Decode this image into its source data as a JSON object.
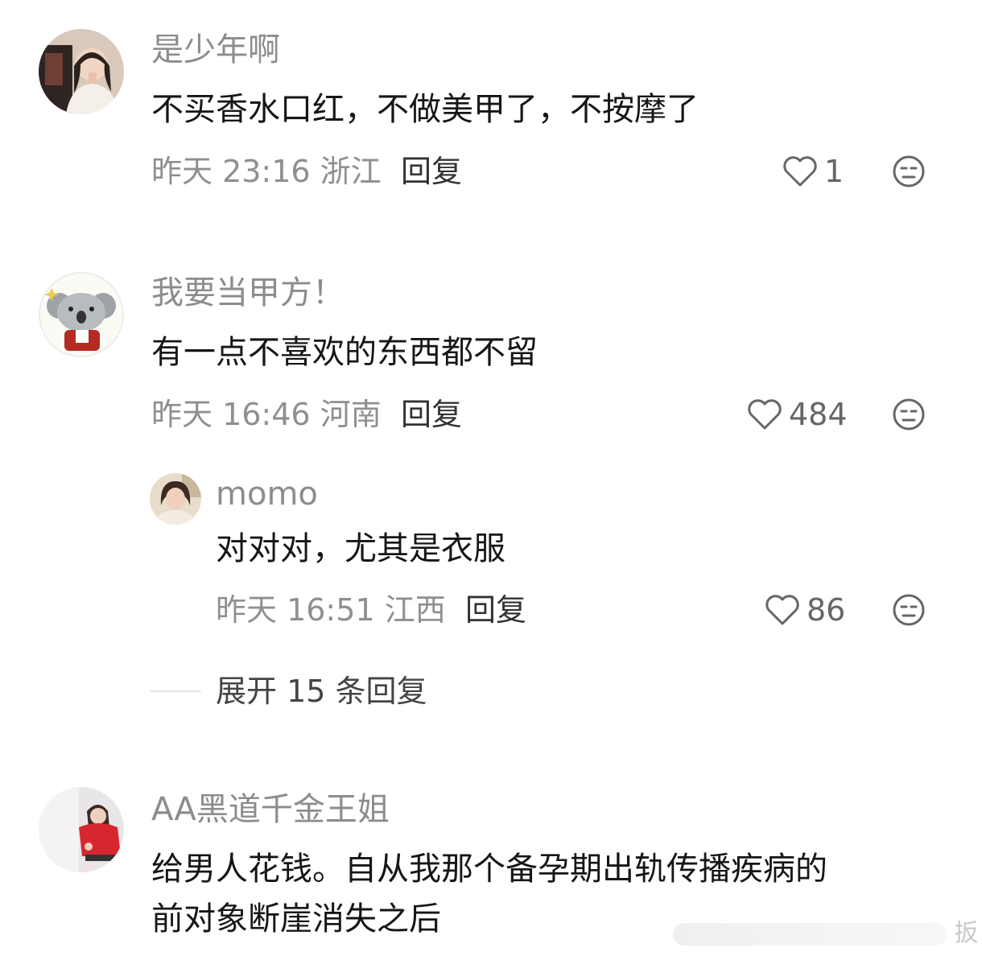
{
  "comments": [
    {
      "username": "是少年啊",
      "text": "不买香水口红，不做美甲了，不按摩了",
      "time": "昨天 23:16",
      "location": "浙江",
      "reply_label": "回复",
      "likes": "1"
    },
    {
      "username": "我要当甲方！",
      "text": "有一点不喜欢的东西都不留",
      "time": "昨天 16:46",
      "location": "河南",
      "reply_label": "回复",
      "likes": "484",
      "sub_reply": {
        "username": "momo",
        "text": "对对对，尤其是衣服",
        "time": "昨天 16:51",
        "location": "江西",
        "reply_label": "回复",
        "likes": "86"
      },
      "expand_label": "展开 15 条回复"
    },
    {
      "username": "AA黑道千金王姐",
      "text_line1": "给男人花钱。自从我那个备孕期出轨传播疾病的",
      "text_line2": "前对象断崖消失之后"
    }
  ],
  "watermark": "扳"
}
